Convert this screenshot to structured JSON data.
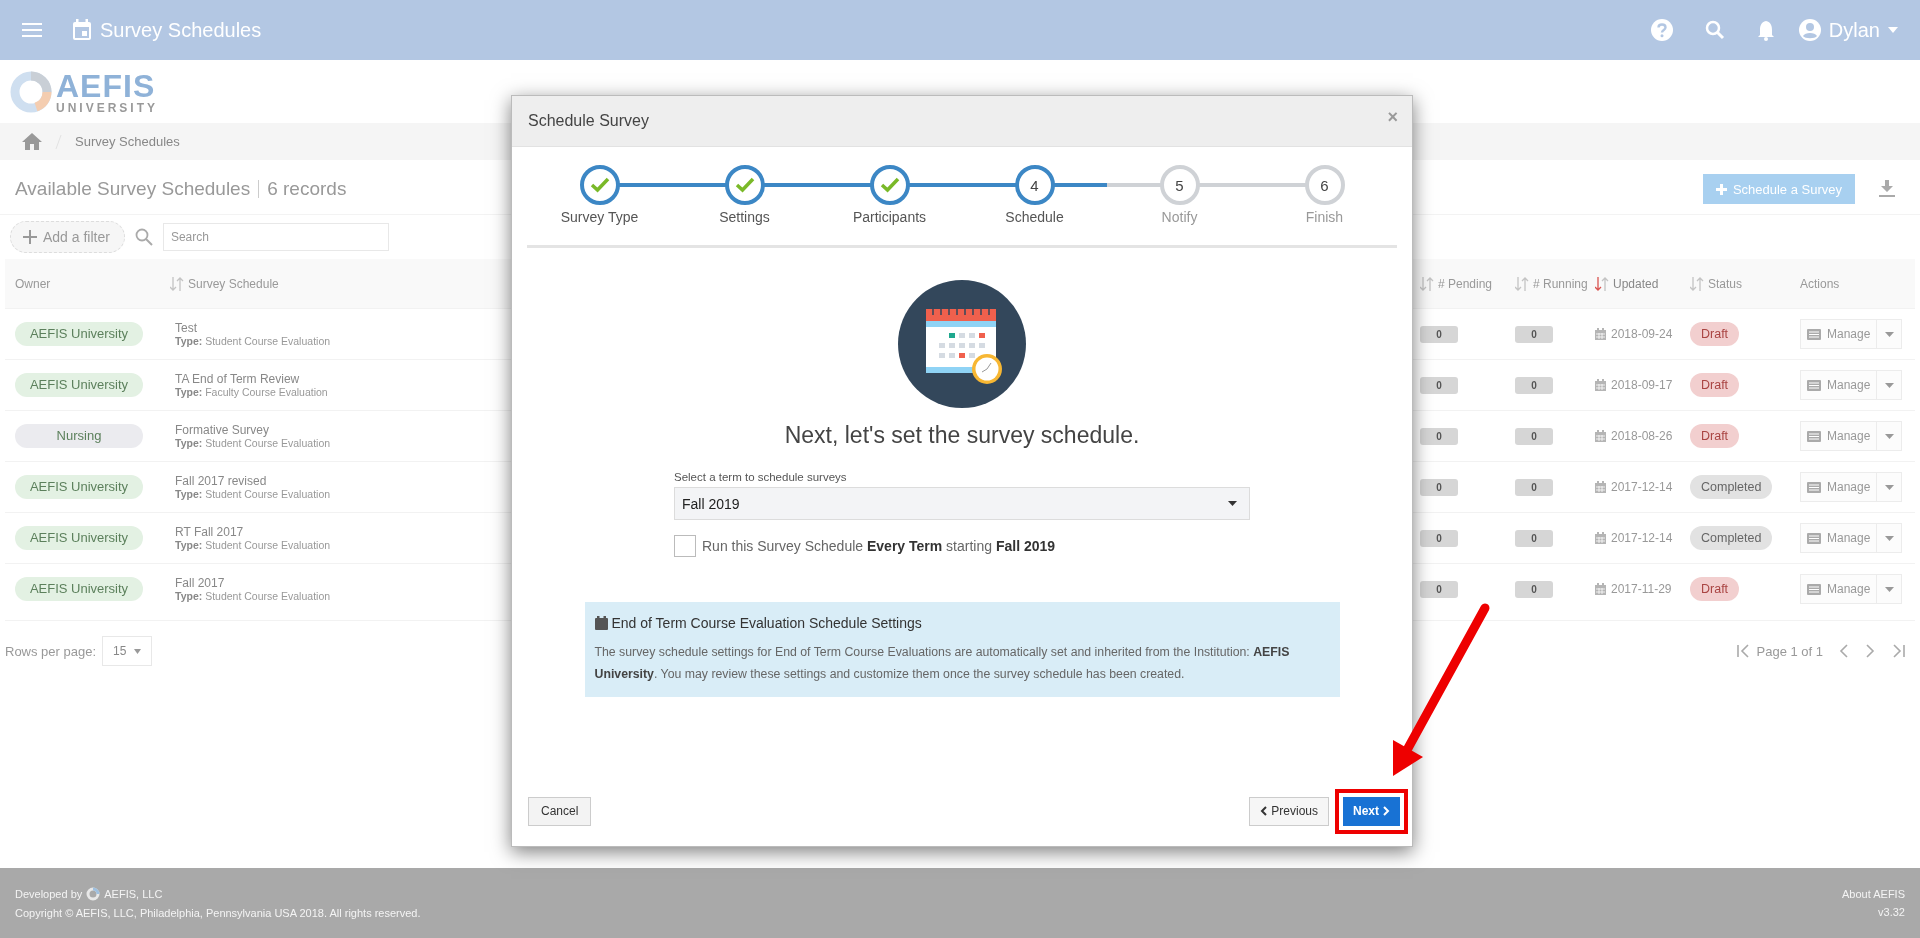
{
  "topbar": {
    "title": "Survey Schedules",
    "user": "Dylan"
  },
  "logo": {
    "name": "AEFIS",
    "subtitle": "UNIVERSITY"
  },
  "breadcrumb": [
    "Survey Schedules"
  ],
  "list": {
    "title": "Available Survey Schedules",
    "count": "6 records",
    "add_button": "Schedule a Survey",
    "filter_button": "Add a filter",
    "search_placeholder": "Search"
  },
  "table": {
    "columns": [
      {
        "label": "Owner",
        "sortable": false,
        "sorted": false
      },
      {
        "label": "Survey Schedule",
        "sortable": true,
        "sorted": false
      },
      {
        "label": "# Pending",
        "sortable": true,
        "sorted": false
      },
      {
        "label": "# Running",
        "sortable": true,
        "sorted": false
      },
      {
        "label": "Updated",
        "sortable": true,
        "sorted": true
      },
      {
        "label": "Status",
        "sortable": true,
        "sorted": false
      },
      {
        "label": "Actions",
        "sortable": false,
        "sorted": false
      }
    ],
    "rows": [
      {
        "owner": "AEFIS University",
        "color": "#e3f1e3",
        "name": "Test",
        "type_label": "Type:",
        "type": "Student Course Evaluation",
        "pending": "0",
        "running": "0",
        "updated": "2018-09-24",
        "status": "Draft",
        "kind": "draft",
        "action": "Manage"
      },
      {
        "owner": "AEFIS University",
        "color": "#e3f1e3",
        "name": "TA End of Term Review",
        "type_label": "Type:",
        "type": "Faculty Course Evaluation",
        "pending": "0",
        "running": "0",
        "updated": "2018-09-17",
        "status": "Draft",
        "kind": "draft",
        "action": "Manage"
      },
      {
        "owner": "Nursing",
        "color": "#ebebef",
        "name": "Formative Survey",
        "type_label": "Type:",
        "type": "Student Course Evaluation",
        "pending": "0",
        "running": "0",
        "updated": "2018-08-26",
        "status": "Draft",
        "kind": "draft",
        "action": "Manage"
      },
      {
        "owner": "AEFIS University",
        "color": "#e3f1e3",
        "name": "Fall 2017 revised",
        "type_label": "Type:",
        "type": "Student Course Evaluation",
        "pending": "0",
        "running": "0",
        "updated": "2017-12-14",
        "status": "Completed",
        "kind": "completed",
        "action": "Manage"
      },
      {
        "owner": "AEFIS University",
        "color": "#e3f1e3",
        "name": "RT Fall 2017",
        "type_label": "Type:",
        "type": "Student Course Evaluation",
        "pending": "0",
        "running": "0",
        "updated": "2017-12-14",
        "status": "Completed",
        "kind": "completed",
        "action": "Manage"
      },
      {
        "owner": "AEFIS University",
        "color": "#e3f1e3",
        "name": "Fall 2017",
        "type_label": "Type:",
        "type": "Student Course Evaluation",
        "pending": "0",
        "running": "0",
        "updated": "2017-11-29",
        "status": "Draft",
        "kind": "draft",
        "action": "Manage"
      }
    ]
  },
  "pagination": {
    "rows_label": "Rows per page:",
    "rows_value": "15",
    "page": "Page 1 of 1"
  },
  "modal": {
    "title": "Schedule Survey",
    "close": "×",
    "steps": [
      {
        "label": "Survey Type",
        "kind": "done"
      },
      {
        "label": "Settings",
        "kind": "done"
      },
      {
        "label": "Participants",
        "kind": "done"
      },
      {
        "label": "Schedule",
        "number": "4",
        "kind": "current"
      },
      {
        "label": "Notify",
        "number": "5",
        "kind": "todo"
      },
      {
        "label": "Finish",
        "number": "6",
        "kind": "todo"
      }
    ],
    "heading": "Next, let's set the survey schedule.",
    "term_label": "Select a term to schedule surveys",
    "term_value": "Fall 2019",
    "repeat": {
      "checked": false,
      "text": "Run this Survey Schedule **Every Term** starting **Fall 2019**"
    },
    "info": {
      "title": "End of Term Course Evaluation Schedule Settings",
      "text": "The survey schedule settings for End of Term Course Evaluations are automatically set and inherited from the Institution: **AEFIS University**. You may review these settings and customize them once the survey schedule has been created."
    },
    "cancel": "Cancel",
    "previous": "Previous",
    "next": "Next"
  },
  "footer": {
    "developed_by": "Developed by",
    "company": "AEFIS, LLC",
    "copyright": "Copyright © AEFIS, LLC, Philadelphia, Pennsylvania USA 2018. All rights reserved.",
    "about": "About AEFIS",
    "version": "v3.32"
  }
}
